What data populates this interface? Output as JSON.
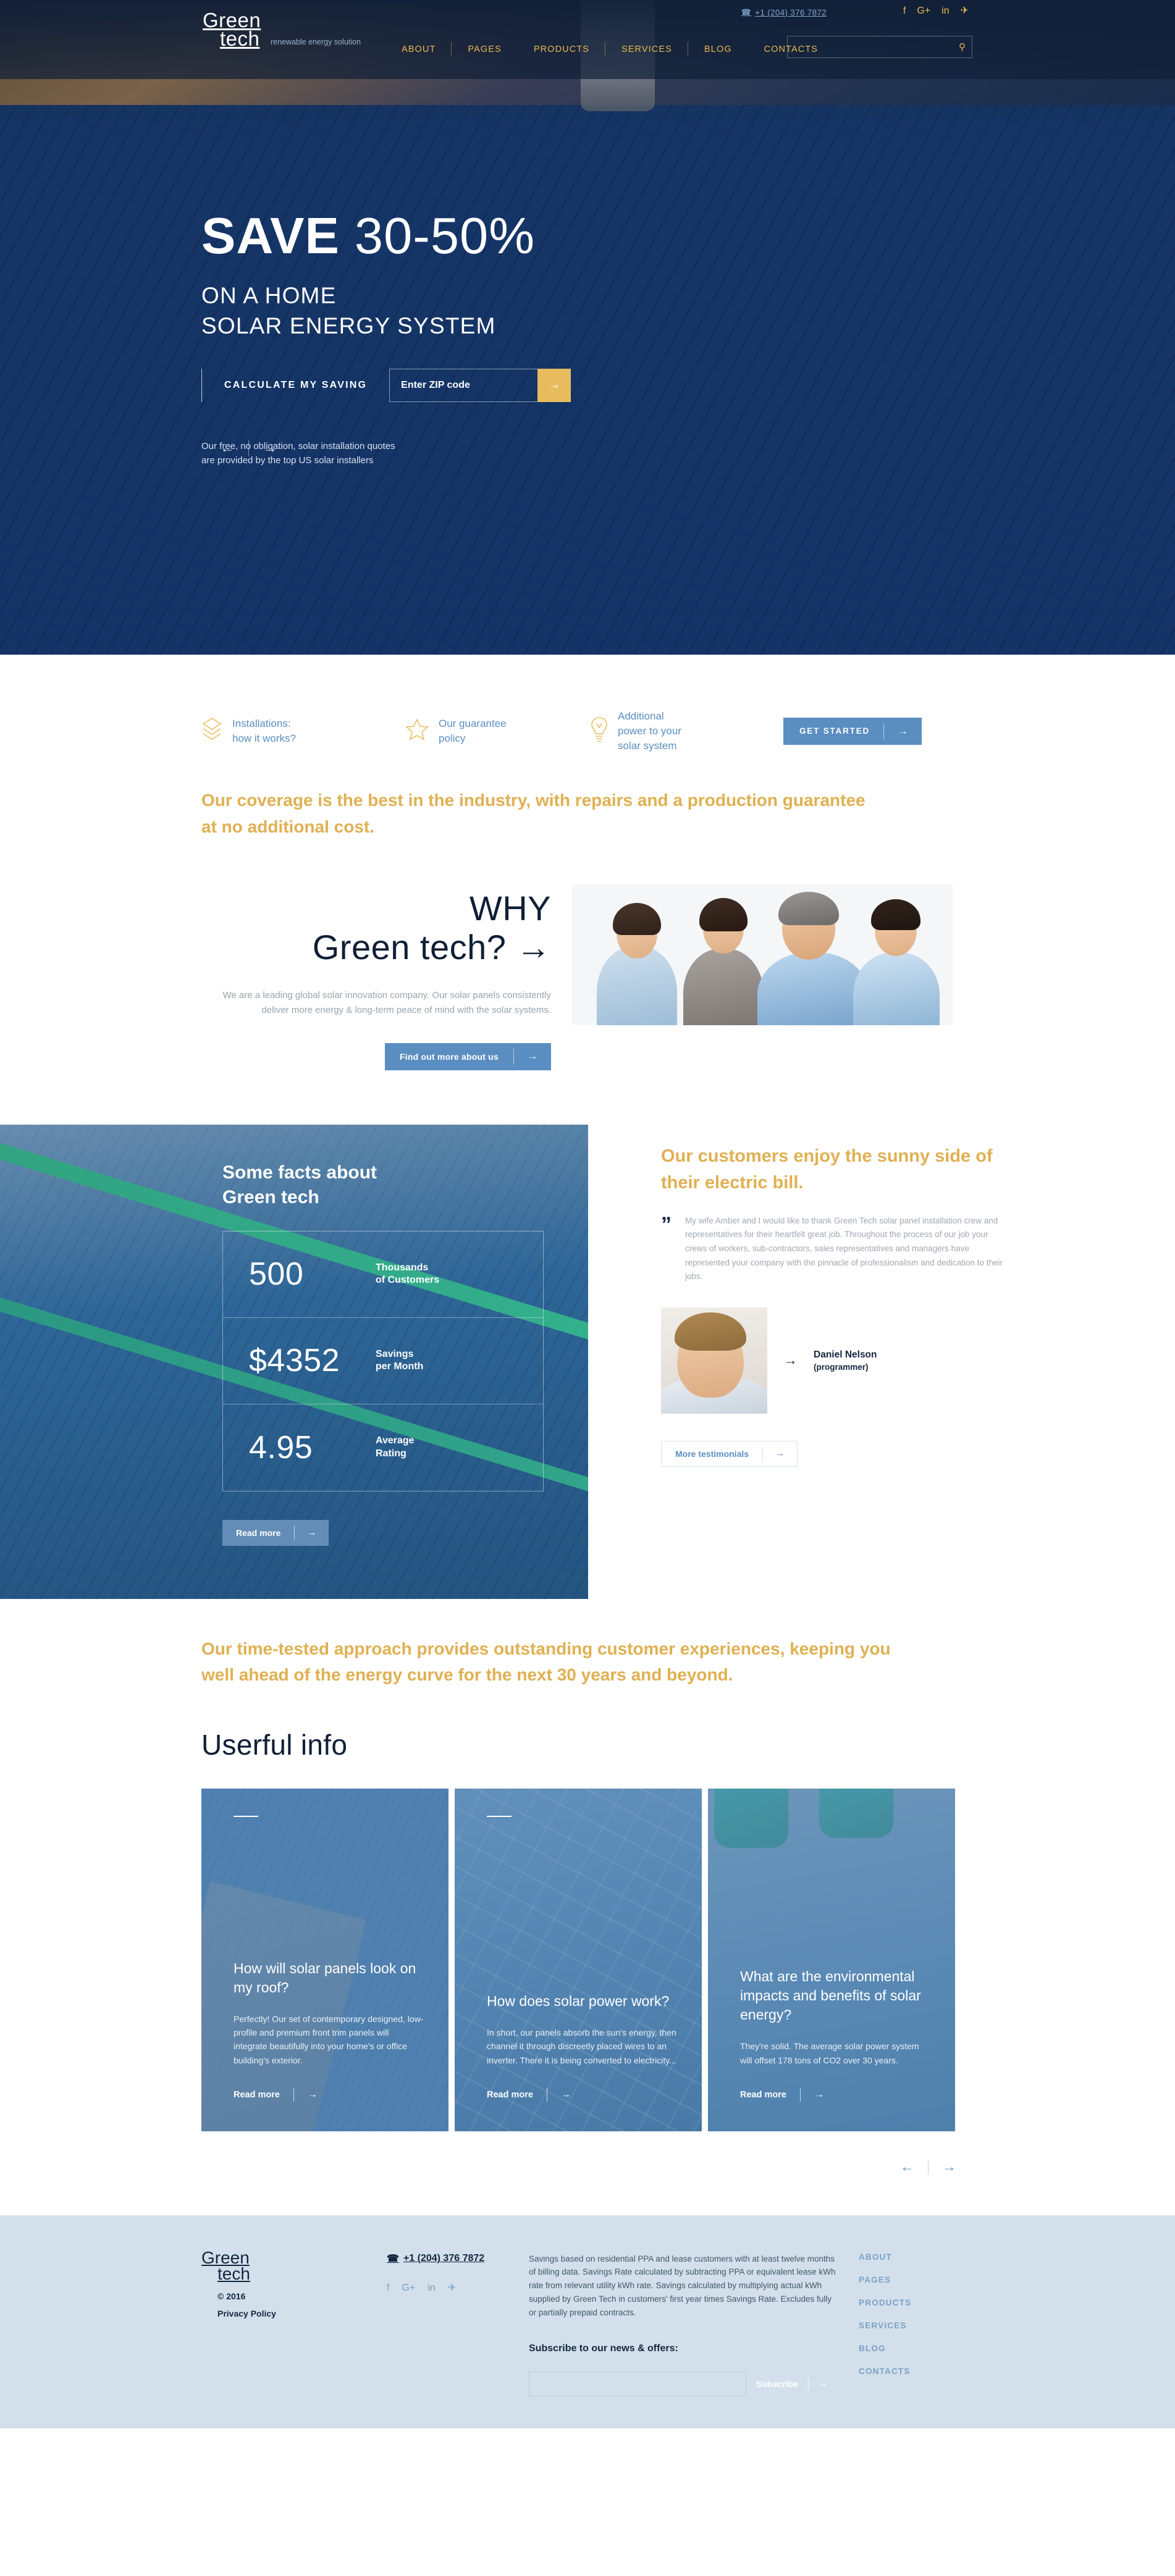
{
  "brand": {
    "line1": "Green",
    "line2": "tech",
    "tagline": "renewable\nenergy solution"
  },
  "header": {
    "nav": [
      {
        "label": "ABOUT"
      },
      {
        "label": "PAGES"
      },
      {
        "label": "PRODUCTS"
      },
      {
        "label": "SERVICES"
      },
      {
        "label": "BLOG"
      },
      {
        "label": "CONTACTS"
      }
    ],
    "phone": "+1 (204) 376 7872",
    "phone_icon": "phone-icon",
    "socials": [
      {
        "name": "facebook-icon",
        "glyph": "f"
      },
      {
        "name": "google-plus-icon",
        "glyph": "G+"
      },
      {
        "name": "linkedin-icon",
        "glyph": "in"
      },
      {
        "name": "twitter-icon",
        "glyph": "✈"
      }
    ],
    "search_placeholder": "",
    "search_value": "",
    "search_icon": "search-icon"
  },
  "hero": {
    "title_strong": "SAVE ",
    "title_num": "30-50%",
    "subtitle": "ON A HOME\nSOLAR ENERGY SYSTEM",
    "calculate_label": "CALCULATE MY SAVING",
    "zip_placeholder": "Enter ZIP code",
    "zip_value": "",
    "zip_go_icon": "arrow-right-icon",
    "note": "Our free, no obligation, solar installation quotes\nare provided by the top US solar installers",
    "prev_icon": "←",
    "next_icon": "→"
  },
  "features": {
    "items": [
      {
        "icon": "layers-icon",
        "label": "Installations:\nhow it works?"
      },
      {
        "icon": "star-icon",
        "label": "Our guarantee\npolicy"
      },
      {
        "icon": "lightbulb-icon",
        "label": "Additional\npower to your\nsolar system"
      }
    ],
    "cta_label": "GET STARTED",
    "cta_icon": "arrow-right-icon"
  },
  "lead": {
    "text": "Our coverage is the best in the industry, with repairs and a production guarantee at no additional cost."
  },
  "why": {
    "heading_line1": "WHY",
    "heading_line2": "Green tech?",
    "heading_arrow": "→",
    "body": "We are a leading global solar innovation company. Our solar panels consistently deliver more energy & long-term peace of mind with the solar systems.",
    "cta_label": "Find out more about us",
    "cta_icon": "arrow-right-icon"
  },
  "facts": {
    "title": "Some facts about\nGreen tech",
    "stats": [
      {
        "value": "500",
        "label": "Thousands\nof Customers"
      },
      {
        "value": "$4352",
        "label": "Savings\nper Month"
      },
      {
        "value": "4.95",
        "label": "Average\nRating"
      }
    ],
    "cta_label": "Read more",
    "cta_icon": "arrow-right-icon"
  },
  "testimonial": {
    "title": "Our customers enjoy the sunny side of their electric bill.",
    "quote_icon": "quote-icon",
    "quote": "My wife Amber and I would like to thank Green Tech solar panel installation crew and representatives for their heartfelt great job. Throughout the process of our job your crews of workers, sub-contractors, sales representatives and managers have represented your company with the pinnacle of professionalism and dedication to their jobs.",
    "author_name": "Daniel Nelson",
    "author_role": "(programmer)",
    "author_arrow": "→",
    "more_label": "More testimonials",
    "more_icon": "arrow-right-icon"
  },
  "approach": {
    "text": "Our time-tested approach provides outstanding customer experiences, keeping you well ahead of the energy curve for the next 30 years and beyond."
  },
  "useful": {
    "heading": "Userful info",
    "cards": [
      {
        "title": "How will solar panels look on my roof?",
        "body": "Perfectly! Our set of contemporary designed, low-profile and premium front trim panels will integrate beautifully into your home's or office building's exterior.",
        "read_label": "Read more",
        "read_icon": "arrow-right-icon"
      },
      {
        "title": "How does solar power work?",
        "body": "In short, our panels absorb the sun's energy, then channel it through discreetly placed wires to an inverter. There it is being converted to electricity...",
        "read_label": "Read more",
        "read_icon": "arrow-right-icon"
      },
      {
        "title": "What are the environmental impacts and benefits of solar energy?",
        "body": "They're solid. The average solar power system will offset 178 tons of CO2 over 30 years.",
        "read_label": "Read more",
        "read_icon": "arrow-right-icon"
      }
    ],
    "prev_icon": "←",
    "next_icon": "→"
  },
  "footer": {
    "copyright": "© 2016",
    "privacy": "Privacy Policy",
    "phone": "+1 (204) 376 7872",
    "phone_icon": "phone-icon",
    "socials": [
      {
        "name": "facebook-icon",
        "glyph": "f"
      },
      {
        "name": "google-plus-icon",
        "glyph": "G+"
      },
      {
        "name": "linkedin-icon",
        "glyph": "in"
      },
      {
        "name": "twitter-icon",
        "glyph": "✈"
      }
    ],
    "disclaimer": "Savings based on residential PPA and lease customers with at least twelve months of billing data. Savings Rate calculated by subtracting PPA or equivalent lease kWh rate from relevant utility kWh rate. Savings calculated by multiplying actual kWh supplied by Green Tech in customers' first year times Savings Rate. Excludes fully or partially prepaid contracts.",
    "subscribe_title": "Subscribe to our news & offers:",
    "subscribe_placeholder": "",
    "subscribe_value": "",
    "subscribe_label": "Subscribe",
    "subscribe_icon": "arrow-right-icon",
    "nav": [
      {
        "label": "ABOUT"
      },
      {
        "label": "PAGES"
      },
      {
        "label": "PRODUCTS"
      },
      {
        "label": "SERVICES"
      },
      {
        "label": "BLOG"
      },
      {
        "label": "CONTACTS"
      }
    ]
  },
  "colors": {
    "accent_gold": "#e0b052",
    "accent_blue": "#5b8ec0",
    "dark_navy": "#14263f",
    "footer_bg": "#d3e0ec"
  }
}
